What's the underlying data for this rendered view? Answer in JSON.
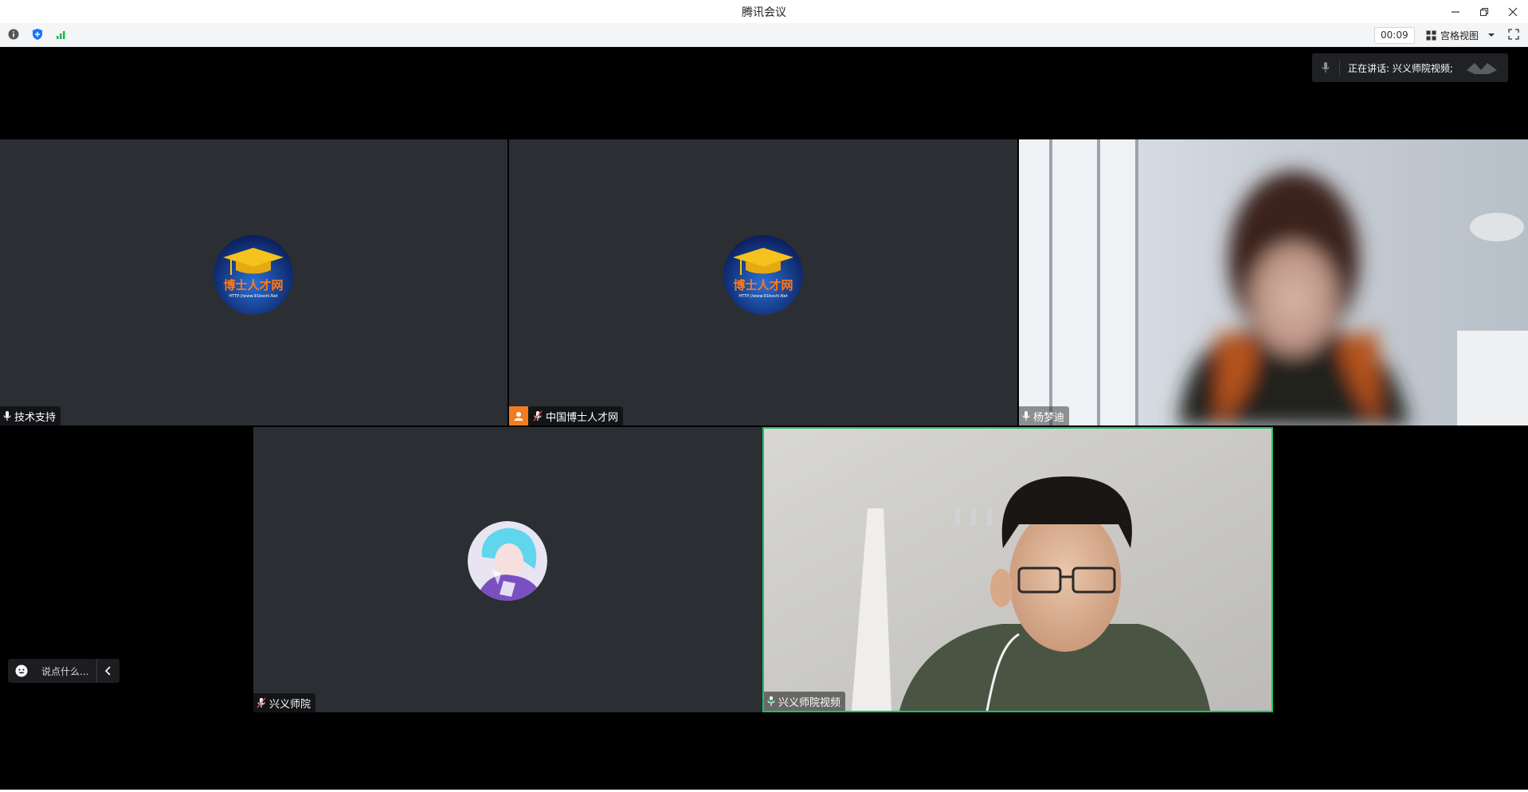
{
  "window": {
    "title": "腾讯会议",
    "controls": [
      "minimize-icon",
      "restore-icon",
      "close-icon"
    ]
  },
  "toolbar": {
    "left_icons": [
      "info-icon",
      "shield-icon",
      "signal-icon"
    ],
    "timer": "00:09",
    "view_label": "宫格视图",
    "right_icons": [
      "grid-icon",
      "caret-down-icon",
      "fullscreen-icon"
    ]
  },
  "speaking": {
    "label": "正在讲话: 兴义师院视频;"
  },
  "tiles": [
    {
      "name": "技术支持",
      "type": "avatar",
      "avatar": "博士人才网 logo",
      "mic": "mic-icon"
    },
    {
      "name": "中国博士人才网",
      "type": "avatar",
      "avatar": "博士人才网 logo",
      "mic": "mic-muted-icon",
      "host": true
    },
    {
      "name": "杨梦迪",
      "type": "video",
      "mic": "mic-icon"
    },
    {
      "name": "兴义师院",
      "type": "avatar",
      "avatar": "anime avatar",
      "mic": "mic-muted-icon"
    },
    {
      "name": "兴义师院视频",
      "type": "video",
      "mic": "mic-active-icon",
      "active": true
    }
  ],
  "logo_text": {
    "main": "博士人才网",
    "url": "HTTP://www.91boshi.Net"
  },
  "chat": {
    "placeholder": "说点什么..."
  },
  "colors": {
    "stage_bg": "#000000",
    "tile_bg": "#2b2e33",
    "active_border": "#1fbf6a",
    "host_badge": "#f47c20",
    "signal_green": "#19b955",
    "shield_blue": "#1677ff"
  }
}
